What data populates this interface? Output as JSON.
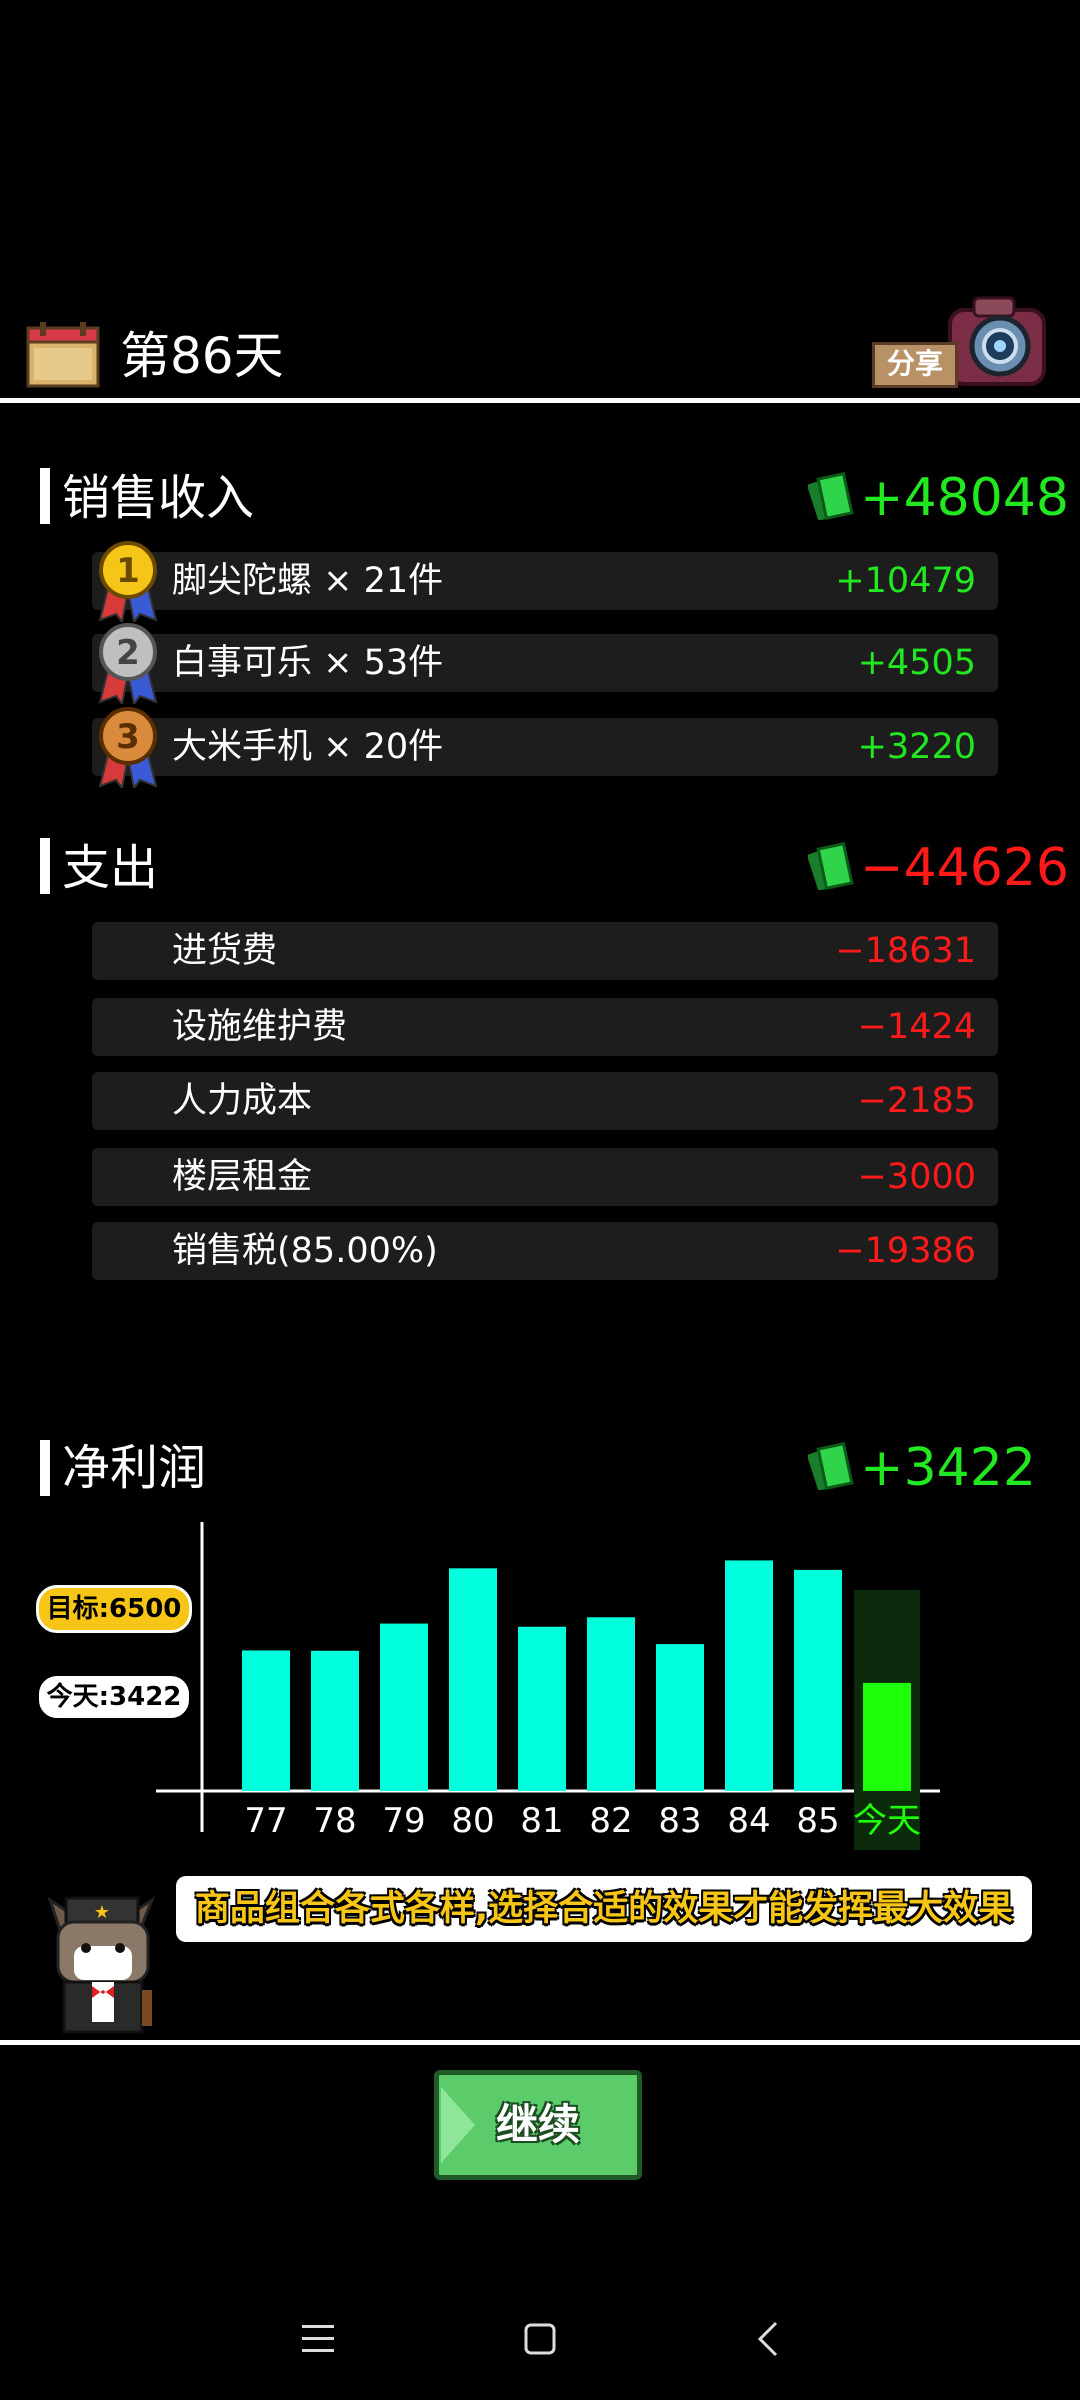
{
  "header": {
    "day_title": "第86天",
    "share_label": "分享"
  },
  "income": {
    "title": "销售收入",
    "total": "+48048",
    "items": [
      {
        "rank": "1",
        "label": "脚尖陀螺 × 21件",
        "value": "+10479"
      },
      {
        "rank": "2",
        "label": "白事可乐 × 53件",
        "value": "+4505"
      },
      {
        "rank": "3",
        "label": "大米手机 × 20件",
        "value": "+3220"
      }
    ]
  },
  "expense": {
    "title": "支出",
    "total": "−44626",
    "items": [
      {
        "label": "进货费",
        "value": "−18631"
      },
      {
        "label": "设施维护费",
        "value": "−1424"
      },
      {
        "label": "人力成本",
        "value": "−2185"
      },
      {
        "label": "楼层租金",
        "value": "−3000"
      },
      {
        "label": "销售税(85.00%)",
        "value": "−19386"
      }
    ]
  },
  "profit": {
    "title": "净利润",
    "total": "+3422"
  },
  "chart_data": {
    "type": "bar",
    "categories": [
      "77",
      "78",
      "79",
      "80",
      "81",
      "82",
      "83",
      "84",
      "85",
      "今天"
    ],
    "values": [
      4450,
      4440,
      5300,
      7050,
      5200,
      5500,
      4650,
      7300,
      7000,
      3422
    ],
    "ylim": [
      0,
      8200
    ],
    "reference_lines": [
      {
        "label": "目标:6500",
        "value": 6500
      },
      {
        "label": "今天:3422",
        "value": 3422
      }
    ],
    "colors": {
      "history": "#00ffdd",
      "today": "#1eff0a",
      "today_bg": "#0c2a0c"
    }
  },
  "tip": "商品组合各式各样,选择合适的效果才能发挥最大效果",
  "continue_label": "继续"
}
